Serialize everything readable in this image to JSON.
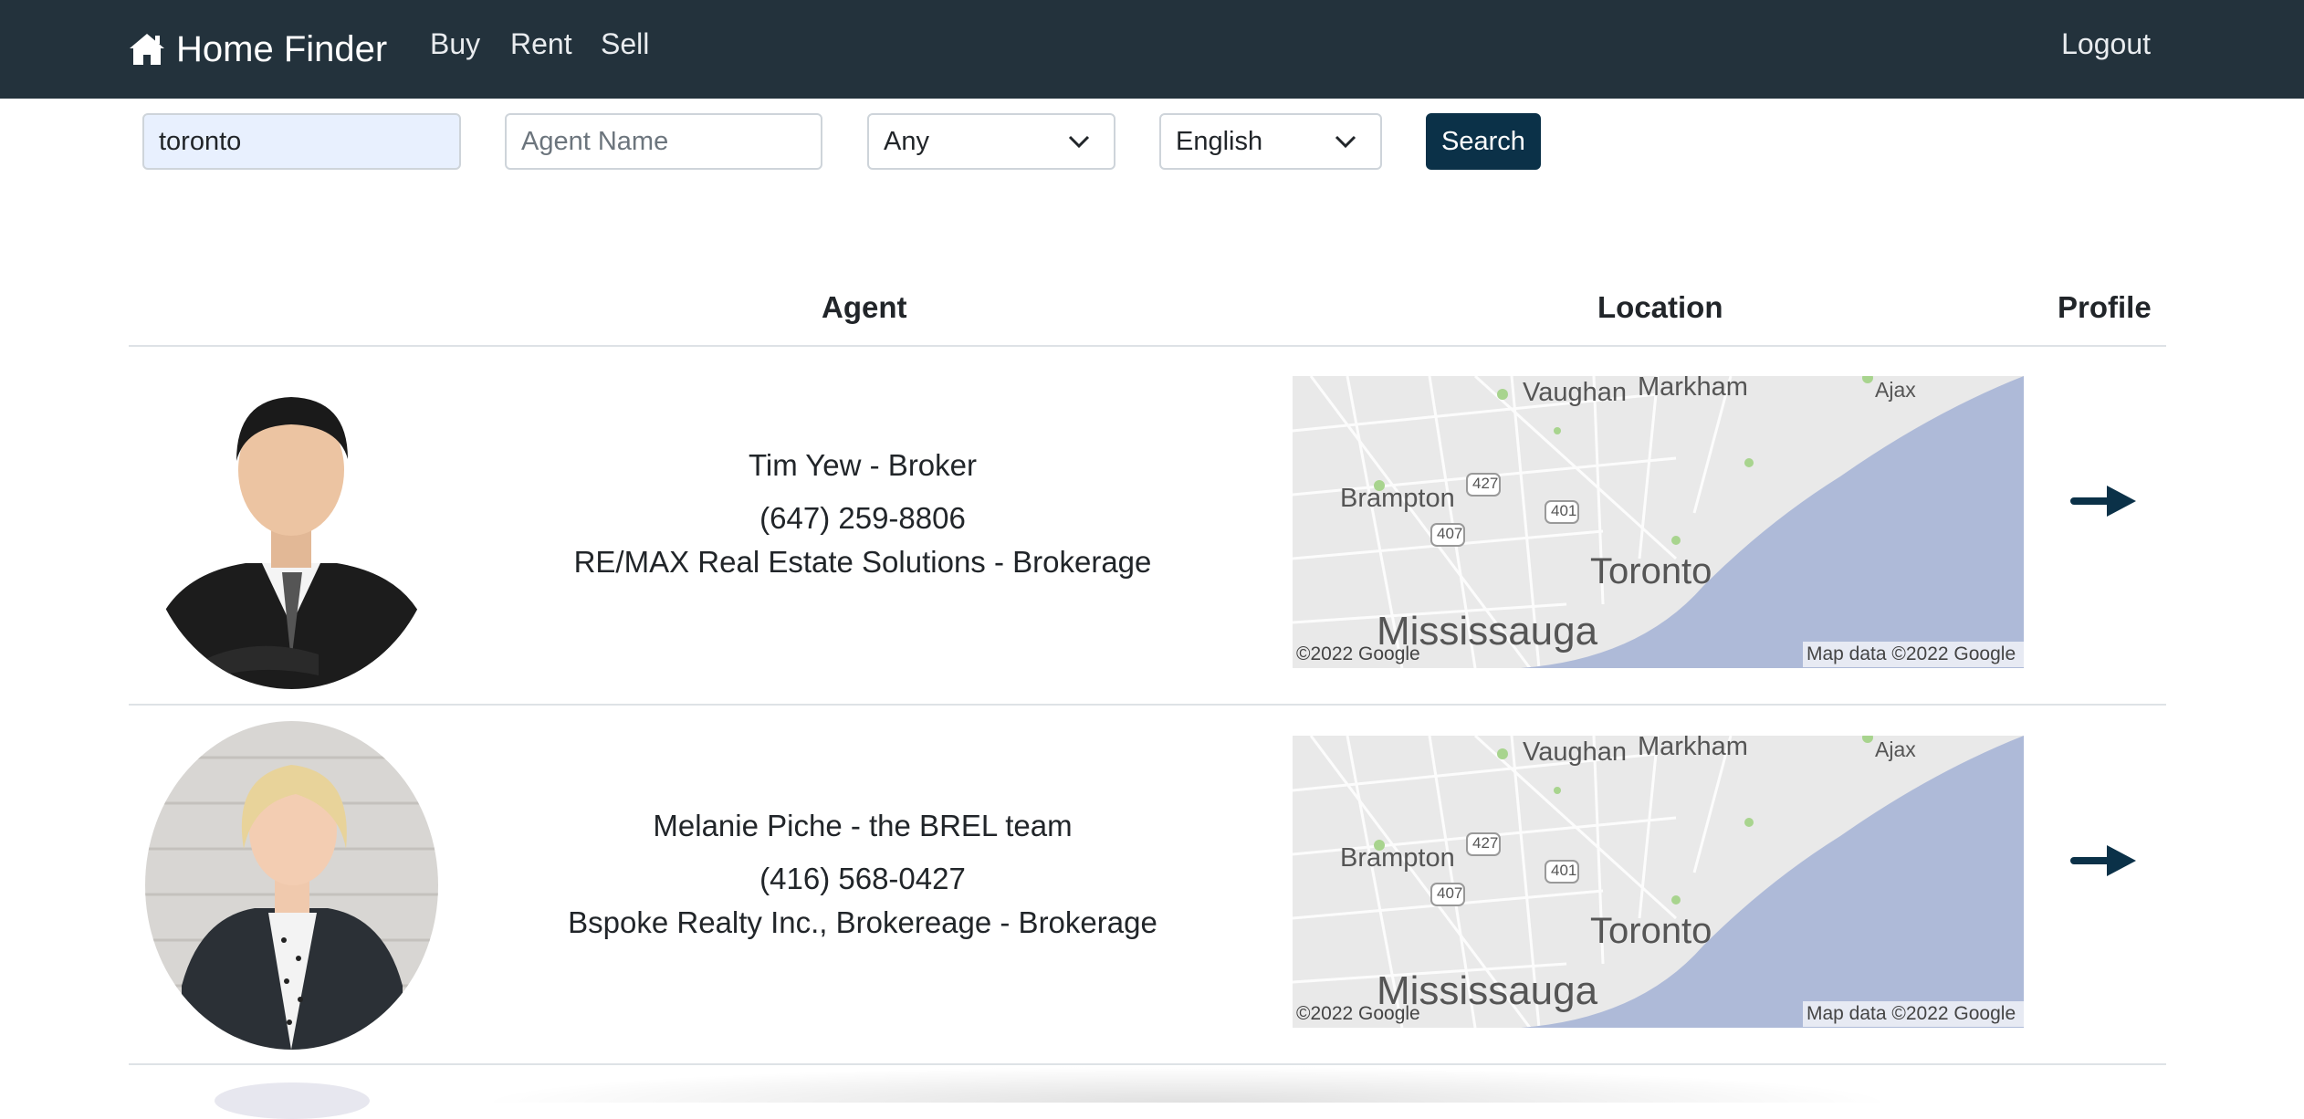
{
  "nav": {
    "brand": "Home Finder",
    "links": [
      "Buy",
      "Rent",
      "Sell"
    ],
    "logout": "Logout"
  },
  "search": {
    "city_value": "toronto",
    "agent_placeholder": "Agent Name",
    "filter_value": "Any",
    "language_value": "English",
    "button": "Search"
  },
  "table": {
    "headers": [
      "Agent",
      "Location",
      "Profile"
    ]
  },
  "agents": [
    {
      "name": "Tim Yew - Broker",
      "phone": "(647) 259-8806",
      "office": "RE/MAX Real Estate Solutions - Brokerage"
    },
    {
      "name": "Melanie Piche - the BREL team",
      "phone": "(416) 568-0427",
      "office": "Bspoke Realty Inc., Brokereage - Brokerage"
    }
  ],
  "map": {
    "labels": [
      "Vaughan",
      "Markham",
      "Ajax",
      "Brampton",
      "Toronto",
      "Mississauga"
    ],
    "shields": [
      "427",
      "407",
      "401"
    ],
    "copyright": "©2022 Google",
    "map_data": "Map data ©2022 Google"
  },
  "colors": {
    "navbar": "#23323c",
    "button": "#0b3148",
    "arrow": "#0b3148",
    "water": "#aebad8",
    "input_autofill": "#e8f0fe"
  }
}
